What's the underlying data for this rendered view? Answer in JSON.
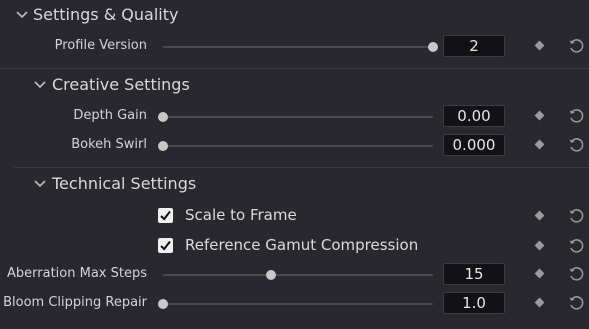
{
  "sections": {
    "settings_quality": {
      "title": "Settings & Quality"
    },
    "creative": {
      "title": "Creative Settings"
    },
    "technical": {
      "title": "Technical Settings"
    }
  },
  "profile_version": {
    "label": "Profile Version",
    "value": "2",
    "slider_fraction": 1.0
  },
  "depth_gain": {
    "label": "Depth Gain",
    "value": "0.00",
    "slider_fraction": 0.0
  },
  "bokeh_swirl": {
    "label": "Bokeh Swirl",
    "value": "0.000",
    "slider_fraction": 0.0
  },
  "scale_to_frame": {
    "label": "Scale to Frame",
    "checked": true
  },
  "reference_gamut": {
    "label": "Reference Gamut Compression",
    "checked": true
  },
  "aberration_max_steps": {
    "label": "Aberration Max Steps",
    "value": "15",
    "slider_fraction": 0.4
  },
  "bloom_clipping_repair": {
    "label": "Bloom Clipping Repair",
    "value": "1.0",
    "slider_fraction": 0.0
  },
  "icons": {
    "collapse": "chevron-down-icon",
    "keyframe": "diamond-icon",
    "reset": "reset-icon"
  },
  "colors": {
    "background": "#28282e",
    "field": "#121214",
    "knob": "#c8c8c8",
    "track": "#4a4a50"
  }
}
